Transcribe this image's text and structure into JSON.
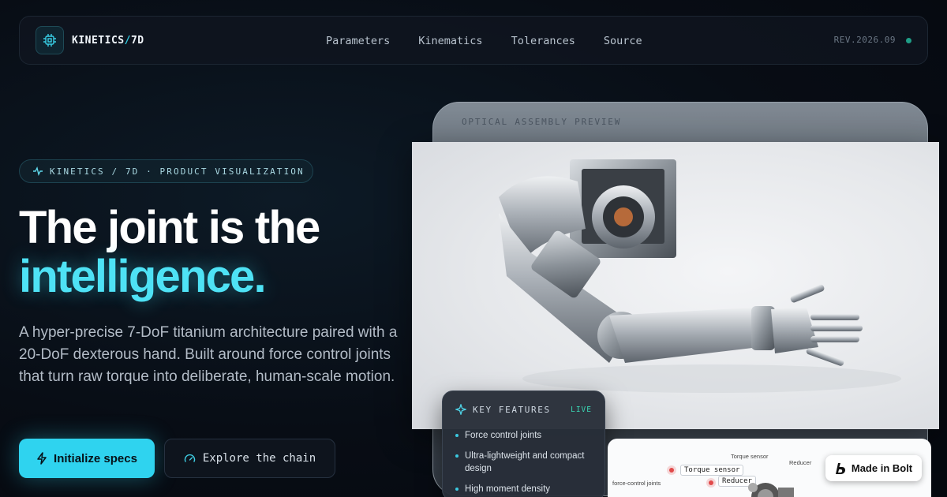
{
  "nav": {
    "brand_prefix": "KINETICS",
    "brand_slash": "/",
    "brand_suffix": "7D",
    "links": [
      "Parameters",
      "Kinematics",
      "Tolerances",
      "Source"
    ],
    "revision": "REV.2026.09",
    "status_color": "#1f9e87"
  },
  "hero": {
    "badge": "KINETICS / 7D · PRODUCT VISUALIZATION",
    "headline_line1": "The joint is the",
    "headline_line2": "intelligence.",
    "description": "A hyper-precise 7-DoF titanium architecture paired with a 20-DoF dexterous hand. Built around force control joints that turn raw torque into deliberate, human-scale motion.",
    "primary_button": "Initialize specs",
    "secondary_button": "Explore the chain",
    "accent_color": "#2fd3ef"
  },
  "visual": {
    "back_panel_label": "OPTICAL ASSEMBLY PREVIEW",
    "features_title": "KEY FEATURES",
    "features_status": "LIVE",
    "features": [
      "Force control joints",
      "Ultra-lightweight and compact design",
      "High moment density"
    ],
    "diagram": {
      "label_top": "Torque sensor",
      "label_reducer": "Reducer",
      "label_left": "force-control joints",
      "tag_torque": "Torque sensor",
      "tag_reducer": "Reducer"
    }
  },
  "badge_bolt": "Made in Bolt"
}
